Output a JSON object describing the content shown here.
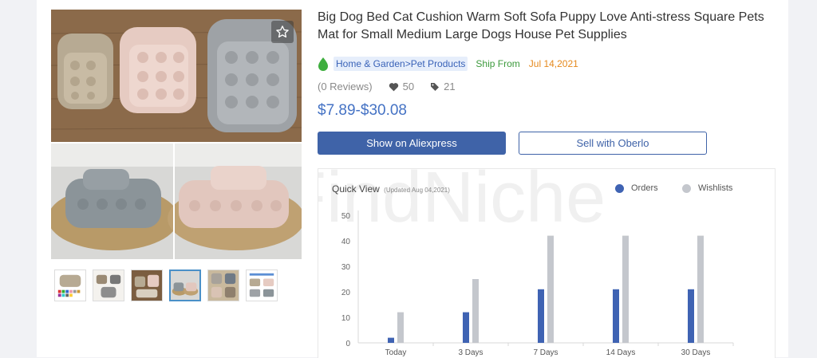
{
  "product": {
    "title": "Big Dog Bed Cat Cushion Warm Soft Sofa Puppy Love Anti-stress Square Pets Mat for Small Medium Large Dogs House Pet Supplies",
    "category": "Home & Garden>Pet Products",
    "ship_from": "Ship From",
    "date": "Jul 14,2021",
    "reviews": "(0 Reviews)",
    "likes": "50",
    "tags": "21",
    "price": "$7.89-$30.08"
  },
  "actions": {
    "aliexpress_label": "Show on Aliexpress",
    "oberlo_label": "Sell with Oberlo"
  },
  "icons": {
    "favorite": "star-icon",
    "leaf": "leaf-icon",
    "heart": "heart-icon",
    "tag": "tag-icon"
  },
  "gallery": {
    "thumb_count": 6,
    "active_index": 3
  },
  "watermark": "FindNiche",
  "chart": {
    "title": "Quick View",
    "subtitle": "(Updated Aug 04,2021)",
    "legend_orders": "Orders",
    "legend_wishlists": "Wishlists"
  },
  "colors": {
    "orders": "#3f63b3",
    "wishlists": "#c4c7cd",
    "accent": "#3f63a8",
    "price": "#4472c4",
    "ship_from": "#3c9a3c",
    "date": "#e5891d"
  },
  "chart_data": {
    "type": "bar",
    "categories": [
      "Today",
      "3 Days",
      "7 Days",
      "14 Days",
      "30 Days"
    ],
    "series": [
      {
        "name": "Orders",
        "values": [
          2,
          12,
          21,
          21,
          21
        ]
      },
      {
        "name": "Wishlists",
        "values": [
          12,
          25,
          42,
          42,
          42
        ]
      }
    ],
    "title": "Quick View",
    "ylim": [
      0,
      50
    ],
    "yticks": [
      0,
      10,
      20,
      30,
      40,
      50
    ],
    "legend": "top-right",
    "grid": false
  }
}
